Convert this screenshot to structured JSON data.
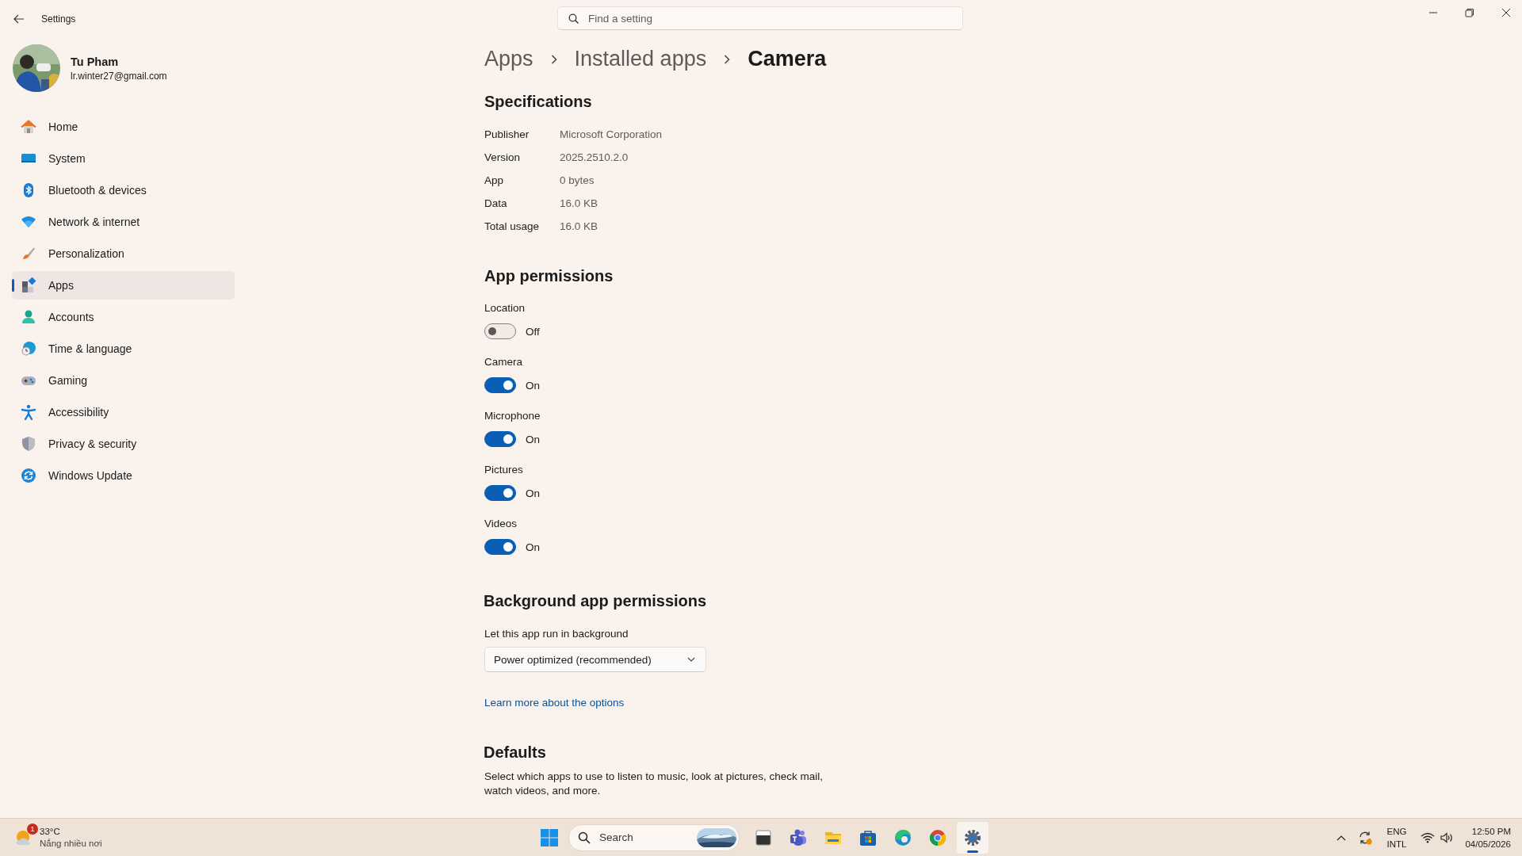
{
  "window": {
    "title": "Settings"
  },
  "search": {
    "placeholder": "Find a setting"
  },
  "user": {
    "name": "Tu Pham",
    "email": "lr.winter27@gmail.com"
  },
  "sidebar": {
    "items": [
      {
        "label": "Home",
        "selected": false
      },
      {
        "label": "System",
        "selected": false
      },
      {
        "label": "Bluetooth & devices",
        "selected": false
      },
      {
        "label": "Network & internet",
        "selected": false
      },
      {
        "label": "Personalization",
        "selected": false
      },
      {
        "label": "Apps",
        "selected": true
      },
      {
        "label": "Accounts",
        "selected": false
      },
      {
        "label": "Time & language",
        "selected": false
      },
      {
        "label": "Gaming",
        "selected": false
      },
      {
        "label": "Accessibility",
        "selected": false
      },
      {
        "label": "Privacy & security",
        "selected": false
      },
      {
        "label": "Windows Update",
        "selected": false
      }
    ]
  },
  "breadcrumb": [
    "Apps",
    "Installed apps",
    "Camera"
  ],
  "specifications": {
    "title": "Specifications",
    "rows": [
      {
        "label": "Publisher",
        "value": "Microsoft Corporation"
      },
      {
        "label": "Version",
        "value": "2025.2510.2.0"
      },
      {
        "label": "App",
        "value": "0 bytes"
      },
      {
        "label": "Data",
        "value": "16.0 KB"
      },
      {
        "label": "Total usage",
        "value": "16.0 KB"
      }
    ]
  },
  "permissions": {
    "title": "App permissions",
    "items": [
      {
        "label": "Location",
        "on": false,
        "state_text": "Off"
      },
      {
        "label": "Camera",
        "on": true,
        "state_text": "On"
      },
      {
        "label": "Microphone",
        "on": true,
        "state_text": "On"
      },
      {
        "label": "Pictures",
        "on": true,
        "state_text": "On"
      },
      {
        "label": "Videos",
        "on": true,
        "state_text": "On"
      }
    ]
  },
  "background": {
    "title": "Background app permissions",
    "label": "Let this app run in background",
    "dropdown": {
      "value": "Power optimized (recommended)"
    },
    "link": "Learn more about the options"
  },
  "defaults": {
    "title": "Defaults",
    "description": "Select which apps to use to listen to music, look at pictures, check mail, watch videos, and more."
  },
  "taskbar": {
    "weather": {
      "badge": "1",
      "temperature": "33°C",
      "condition": "Nắng nhiều nơi"
    },
    "search": {
      "placeholder": "Search"
    },
    "apps": [
      {
        "selected": false
      },
      {
        "selected": false
      },
      {
        "selected": false
      },
      {
        "selected": false
      },
      {
        "selected": false
      },
      {
        "selected": false
      },
      {
        "selected": true
      }
    ],
    "tray": {
      "language": "ENG",
      "layout": "INTL",
      "time": "12:50 PM",
      "date": "04/05/2026"
    }
  }
}
